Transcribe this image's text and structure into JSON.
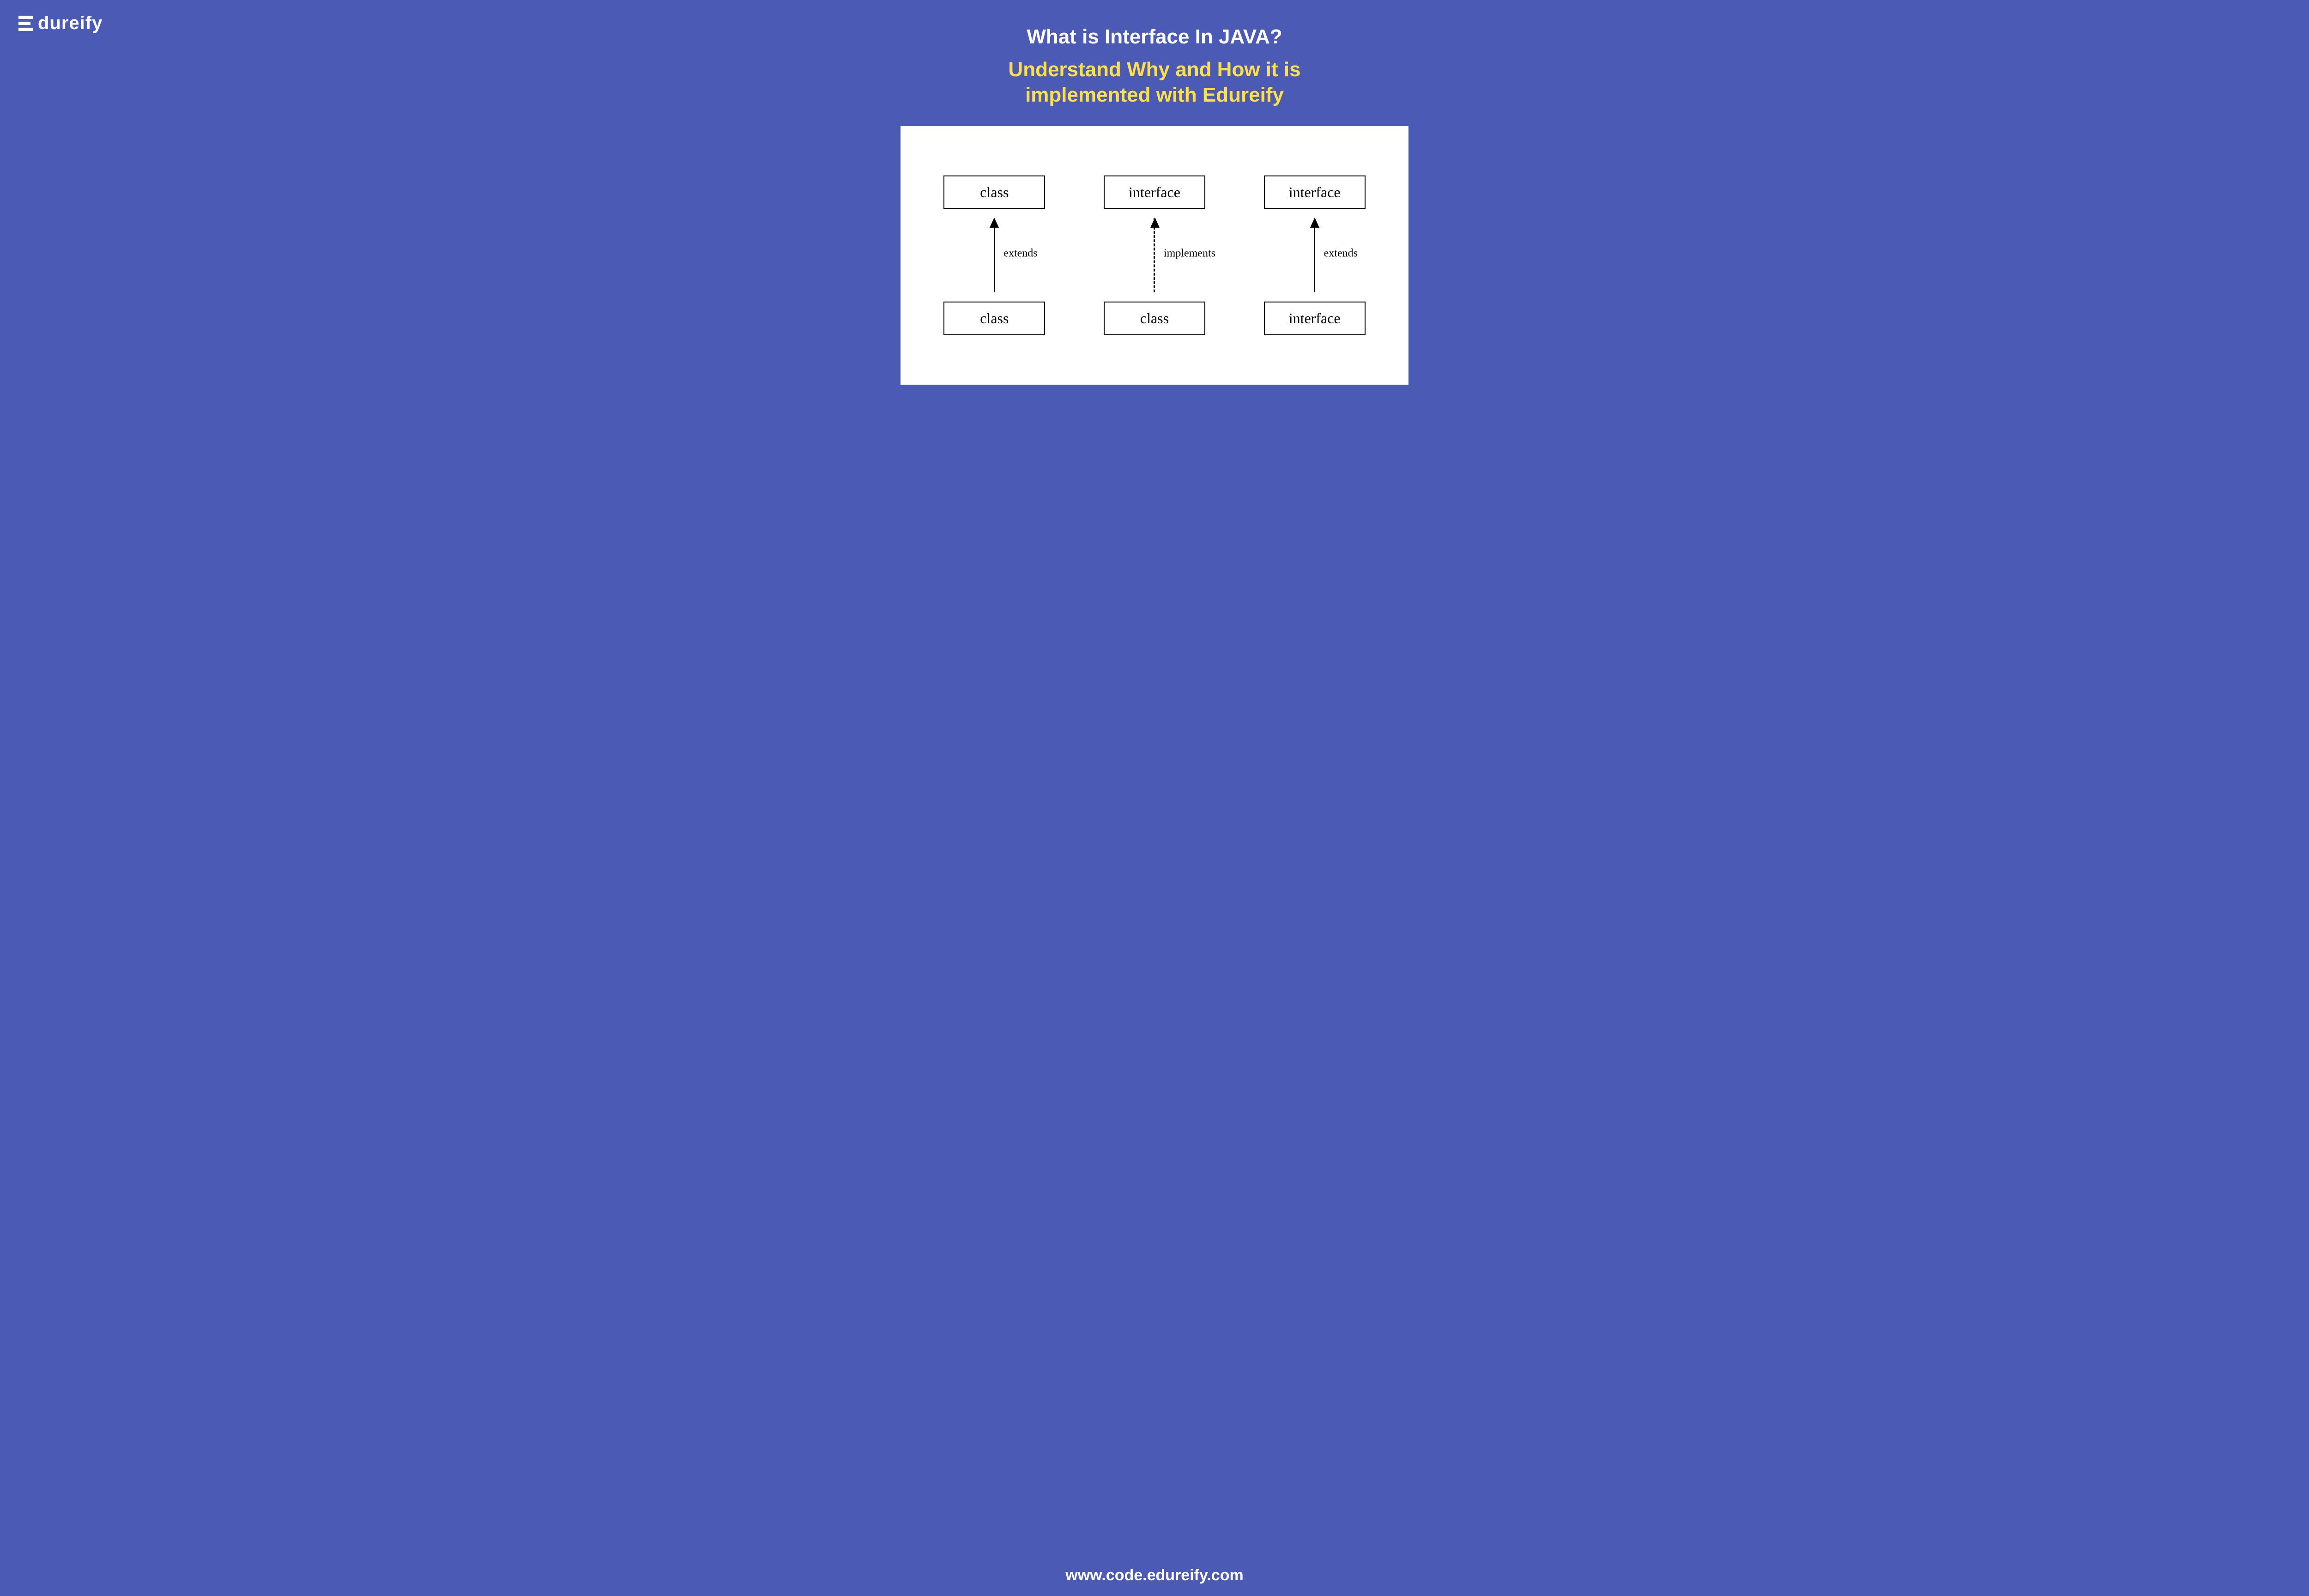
{
  "logo": {
    "text": "dureify"
  },
  "title": "What is Interface In JAVA?",
  "subtitle": "Understand Why and How it is implemented with Edureify",
  "footer": "www.code.edureify.com",
  "diagram": {
    "columns": [
      {
        "top": "class",
        "bottom": "class",
        "label": "extends",
        "dashed": false
      },
      {
        "top": "interface",
        "bottom": "class",
        "label": "implements",
        "dashed": true
      },
      {
        "top": "interface",
        "bottom": "interface",
        "label": "extends",
        "dashed": false
      }
    ]
  }
}
